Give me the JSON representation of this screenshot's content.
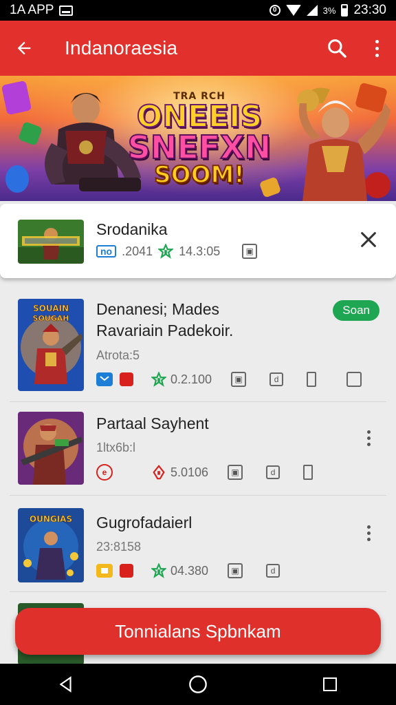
{
  "status_bar": {
    "left_text": "1A APP",
    "time": "23:30",
    "battery_text": "3%"
  },
  "app_bar": {
    "title": "Indanoraesia"
  },
  "banner": {
    "line1": "TRA RCH",
    "line2": "ONEEIS",
    "line3": "SNEFXN",
    "line4": "SOOM!"
  },
  "featured": {
    "name": "Srodanika",
    "tag": "no",
    "meta1": ".2041",
    "meta2": "14.3:05"
  },
  "list": [
    {
      "title": "Denanesi; Mades Ravariain Padekoir.",
      "sub": "Atrota:5",
      "rating": "0.2.100",
      "badge": "Soan",
      "thumb_text": "SOUAIN SOUGAH",
      "accent": "#3b6bd6"
    },
    {
      "title": "Partaal Sayhent",
      "sub": "1ltx6b:l",
      "rating": "5.0106",
      "thumb_text": "",
      "accent": "#c0392b"
    },
    {
      "title": "Gugrofadaierl",
      "sub": "23:8158",
      "rating": "04.380",
      "thumb_text": "OUNGIAS",
      "accent": "#2a63c7"
    }
  ],
  "cta": {
    "label": "Tonnialans Spbnkam"
  },
  "colors": {
    "primary": "#e2312d",
    "green": "#1fa653",
    "blue": "#1c7ed6"
  }
}
